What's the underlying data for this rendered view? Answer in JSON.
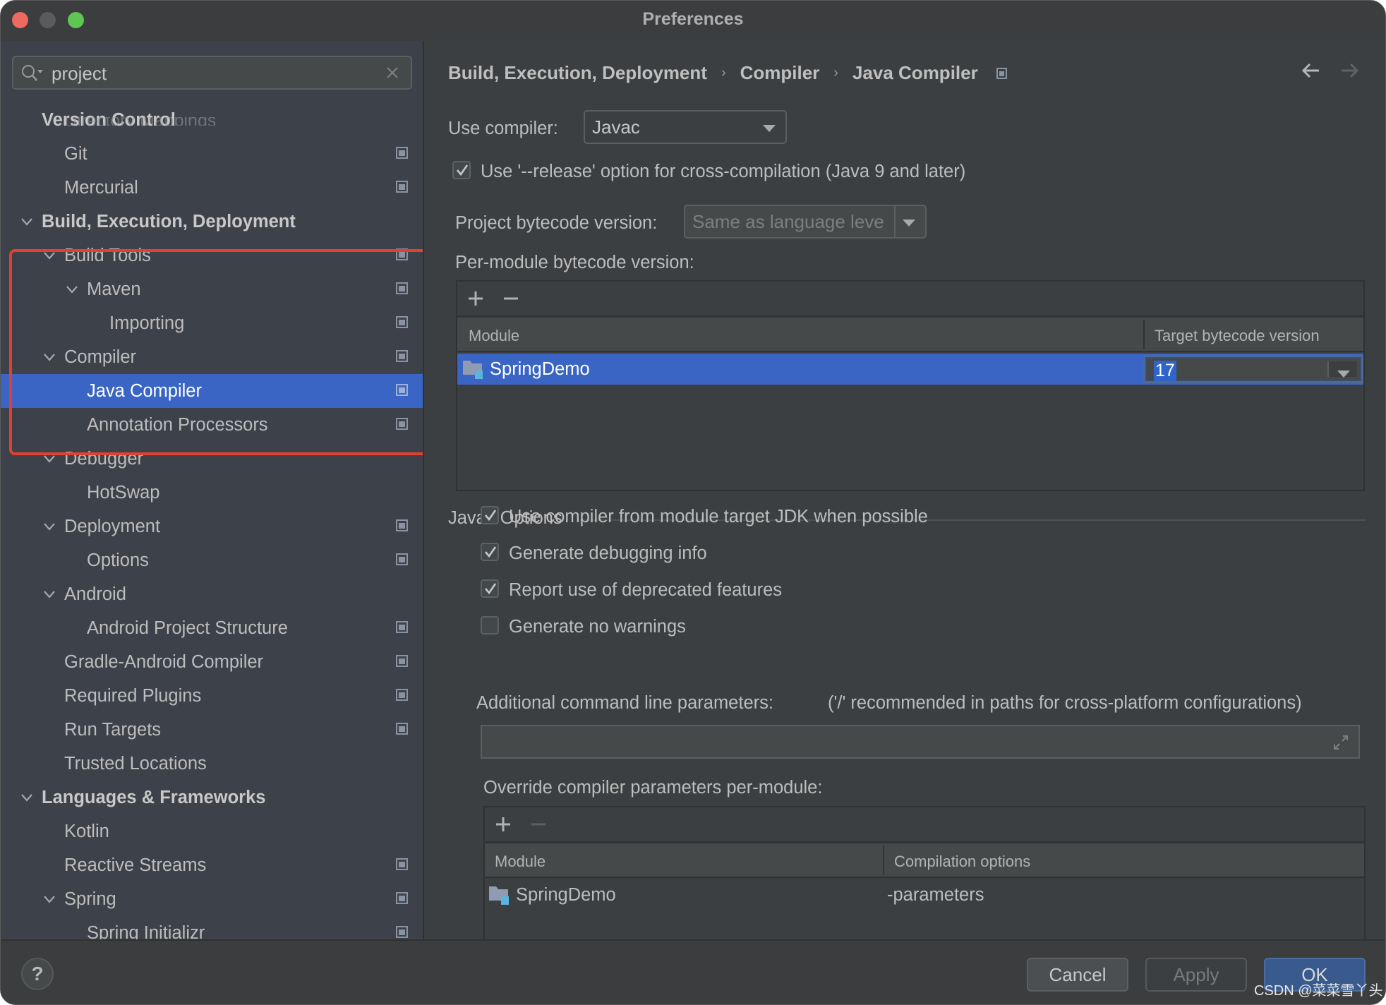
{
  "window": {
    "title": "Preferences",
    "controls": [
      "close",
      "minimize",
      "maximize"
    ]
  },
  "search": {
    "value": "project",
    "icon": "search-icon",
    "clear_icon": "close-icon"
  },
  "sidebar": {
    "ghost_text": "Directory Mappings",
    "items": [
      {
        "label": "Version Control",
        "level": 0,
        "bold": true,
        "chevron": false,
        "project_icon": false
      },
      {
        "label": "Git",
        "level": 1,
        "bold": false,
        "chevron": false,
        "project_icon": true
      },
      {
        "label": "Mercurial",
        "level": 1,
        "bold": false,
        "chevron": false,
        "project_icon": true
      },
      {
        "label": "Build, Execution, Deployment",
        "level": 0,
        "bold": true,
        "chevron": true,
        "project_icon": false
      },
      {
        "label": "Build Tools",
        "level": 1,
        "bold": false,
        "chevron": true,
        "project_icon": true
      },
      {
        "label": "Maven",
        "level": 2,
        "bold": false,
        "chevron": true,
        "project_icon": true
      },
      {
        "label": "Importing",
        "level": 3,
        "bold": false,
        "chevron": false,
        "project_icon": true
      },
      {
        "label": "Compiler",
        "level": 1,
        "bold": false,
        "chevron": true,
        "project_icon": true
      },
      {
        "label": "Java Compiler",
        "level": 2,
        "bold": false,
        "chevron": false,
        "project_icon": true,
        "selected": true
      },
      {
        "label": "Annotation Processors",
        "level": 2,
        "bold": false,
        "chevron": false,
        "project_icon": true
      },
      {
        "label": "Debugger",
        "level": 1,
        "bold": false,
        "chevron": true,
        "project_icon": false
      },
      {
        "label": "HotSwap",
        "level": 2,
        "bold": false,
        "chevron": false,
        "project_icon": false
      },
      {
        "label": "Deployment",
        "level": 1,
        "bold": false,
        "chevron": true,
        "project_icon": true
      },
      {
        "label": "Options",
        "level": 2,
        "bold": false,
        "chevron": false,
        "project_icon": true
      },
      {
        "label": "Android",
        "level": 1,
        "bold": false,
        "chevron": true,
        "project_icon": false
      },
      {
        "label": "Android Project Structure",
        "level": 2,
        "bold": false,
        "chevron": false,
        "project_icon": true
      },
      {
        "label": "Gradle-Android Compiler",
        "level": 1,
        "bold": false,
        "chevron": false,
        "project_icon": true
      },
      {
        "label": "Required Plugins",
        "level": 1,
        "bold": false,
        "chevron": false,
        "project_icon": true
      },
      {
        "label": "Run Targets",
        "level": 1,
        "bold": false,
        "chevron": false,
        "project_icon": true
      },
      {
        "label": "Trusted Locations",
        "level": 1,
        "bold": false,
        "chevron": false,
        "project_icon": false
      },
      {
        "label": "Languages & Frameworks",
        "level": 0,
        "bold": true,
        "chevron": true,
        "project_icon": false
      },
      {
        "label": "Kotlin",
        "level": 1,
        "bold": false,
        "chevron": false,
        "project_icon": false
      },
      {
        "label": "Reactive Streams",
        "level": 1,
        "bold": false,
        "chevron": false,
        "project_icon": true
      },
      {
        "label": "Spring",
        "level": 1,
        "bold": false,
        "chevron": true,
        "project_icon": true
      },
      {
        "label": "Spring Initializr",
        "level": 2,
        "bold": false,
        "chevron": false,
        "project_icon": true
      }
    ],
    "highlight_color": "#e3402f"
  },
  "breadcrumb": {
    "items": [
      "Build, Execution, Deployment",
      "Compiler",
      "Java Compiler"
    ],
    "separator": "›"
  },
  "main": {
    "use_compiler_label": "Use compiler:",
    "use_compiler_value": "Javac",
    "release_option": {
      "label": "Use '--release' option for cross-compilation (Java 9 and later)",
      "checked": true
    },
    "project_bytecode_label": "Project bytecode version:",
    "project_bytecode_placeholder": "Same as language leve",
    "per_module_label": "Per-module bytecode version:",
    "bytecode_table": {
      "columns": [
        "Module",
        "Target bytecode version"
      ],
      "rows": [
        {
          "module": "SpringDemo",
          "target": "17",
          "selected": true
        }
      ]
    },
    "javac_options_title": "Javac Options",
    "javac_checkboxes": [
      {
        "label": "Use compiler from module target JDK when possible",
        "checked": true
      },
      {
        "label": "Generate debugging info",
        "checked": true
      },
      {
        "label": "Report use of deprecated features",
        "checked": true
      },
      {
        "label": "Generate no warnings",
        "checked": false
      }
    ],
    "additional_params_label": "Additional command line parameters:",
    "additional_params_hint": "('/' recommended in paths for cross-platform configurations)",
    "additional_params_value": "",
    "override_label": "Override compiler parameters per-module:",
    "override_table": {
      "columns": [
        "Module",
        "Compilation options"
      ],
      "rows": [
        {
          "module": "SpringDemo",
          "options": "-parameters"
        }
      ]
    }
  },
  "footer": {
    "help": "?",
    "cancel": "Cancel",
    "apply": "Apply",
    "ok": "OK",
    "watermark": "CSDN @菜菜雪丫头"
  },
  "colors": {
    "selection": "#3a65c4",
    "ok_button": "#385a8c",
    "close": "#ee6a5e",
    "maximize": "#5fc553"
  }
}
